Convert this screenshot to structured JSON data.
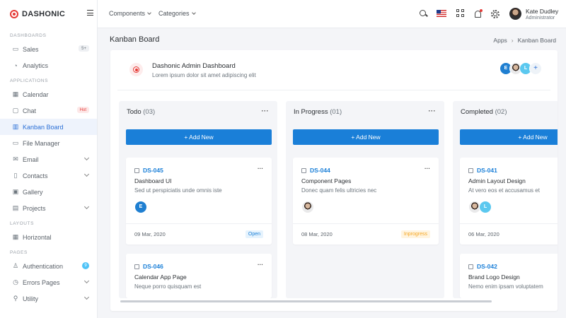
{
  "brand": {
    "name": "DASHONIC"
  },
  "sidebar": {
    "sections": [
      {
        "title": "DASHBOARDS"
      },
      {
        "title": "APPLICATIONS"
      },
      {
        "title": "LAYOUTS"
      },
      {
        "title": "PAGES"
      }
    ],
    "items": [
      {
        "label": "Sales",
        "icon": "monitor-icon",
        "badge": "5+"
      },
      {
        "label": "Analytics",
        "icon": "pie-chart-icon"
      },
      {
        "label": "Calendar",
        "icon": "calendar-icon"
      },
      {
        "label": "Chat",
        "icon": "chat-icon",
        "badge": "Hot"
      },
      {
        "label": "Kanban Board",
        "icon": "kanban-icon"
      },
      {
        "label": "File Manager",
        "icon": "folder-icon"
      },
      {
        "label": "Email",
        "icon": "mail-icon"
      },
      {
        "label": "Contacts",
        "icon": "contacts-icon"
      },
      {
        "label": "Gallery",
        "icon": "image-icon"
      },
      {
        "label": "Projects",
        "icon": "briefcase-icon"
      },
      {
        "label": "Horizontal",
        "icon": "layout-icon"
      },
      {
        "label": "Authentication",
        "icon": "user-icon",
        "badge": "9"
      },
      {
        "label": "Errors Pages",
        "icon": "alert-icon"
      },
      {
        "label": "Utility",
        "icon": "tool-icon"
      }
    ]
  },
  "topbar": {
    "nav": [
      "Components",
      "Categories"
    ],
    "user": {
      "name": "Kate Dudley",
      "role": "Administrator"
    }
  },
  "page": {
    "title": "Kanban Board",
    "breadcrumb": [
      "Apps",
      "Kanban Board"
    ]
  },
  "project": {
    "title": "Dashonic Admin Dashboard",
    "subtitle": "Lorem ipsum dolor sit amet adipiscing elit",
    "team": [
      "E",
      "",
      "L",
      "+"
    ]
  },
  "columns": [
    {
      "title": "Todo",
      "count": "(03)",
      "add_label": "+ Add New",
      "tasks": [
        {
          "id": "DS-045",
          "title": "Dashboard UI",
          "desc": "Sed ut perspiciatis unde omnis iste",
          "avatars": [
            "E"
          ],
          "date": "09 Mar, 2020",
          "status": "Open"
        },
        {
          "id": "DS-046",
          "title": "Calendar App Page",
          "desc": "Neque porro quisquam est"
        }
      ]
    },
    {
      "title": "In Progress",
      "count": "(01)",
      "add_label": "+ Add New",
      "tasks": [
        {
          "id": "DS-044",
          "title": "Component Pages",
          "desc": "Donec quam felis ultricies nec",
          "avatars": [
            ""
          ],
          "date": "08 Mar, 2020",
          "status": "Inprogress"
        }
      ]
    },
    {
      "title": "Completed",
      "count": "(02)",
      "add_label": "+ Add New",
      "tasks": [
        {
          "id": "DS-041",
          "title": "Admin Layout Design",
          "desc": "At vero eos et accusamus et",
          "avatars": [
            "",
            "L"
          ],
          "date": "06 Mar, 2020"
        },
        {
          "id": "DS-042",
          "title": "Brand Logo Design",
          "desc": "Nemo enim ipsam voluptatem"
        }
      ]
    }
  ],
  "colors": {
    "accent": "#1a7fd8",
    "brand_red": "#e53935",
    "active_bg": "#eef3fc"
  }
}
